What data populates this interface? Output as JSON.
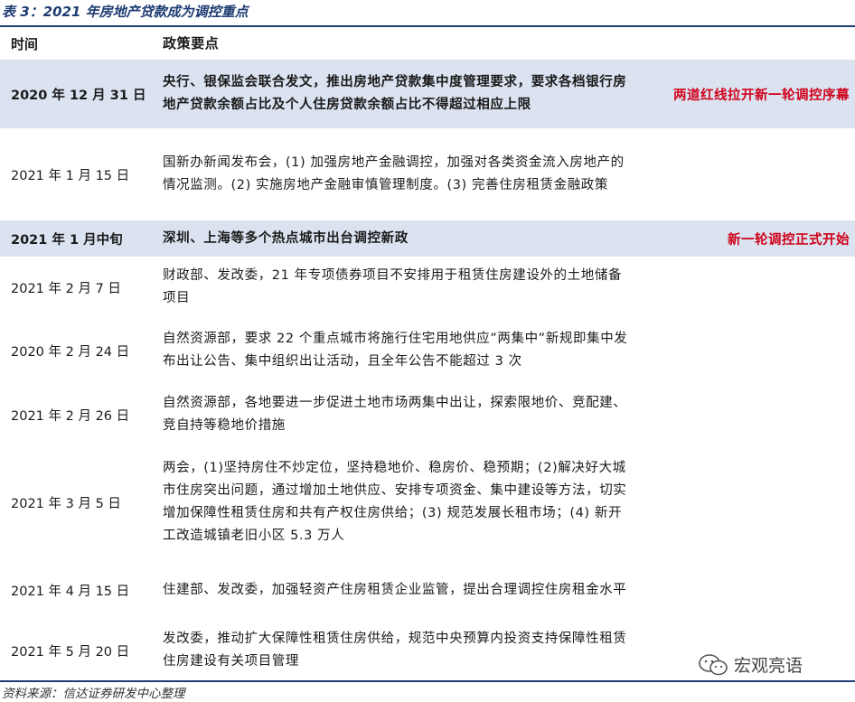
{
  "caption": "表 3：2021 年房地产贷款成为调控重点",
  "header": {
    "time": "时间",
    "points": "政策要点",
    "note": ""
  },
  "rows": [
    {
      "time": "2020 年 12 月 31 日",
      "points": "央行、银保监会联合发文，推出房地产贷款集中度管理要求，要求各档银行房地产贷款余额占比及个人住房贷款余额占比不得超过相应上限",
      "note": "两道红线拉开新一轮调控序幕",
      "highlight": true
    },
    {
      "time": "2021 年 1 月 15 日",
      "points": "国新办新闻发布会，(1) 加强房地产金融调控，加强对各类资金流入房地产的情况监测。(2) 实施房地产金融审慎管理制度。(3) 完善住房租赁金融政策",
      "note": "",
      "highlight": false
    },
    {
      "time": "2021 年 1 月中旬",
      "points": "深圳、上海等多个热点城市出台调控新政",
      "note": "新一轮调控正式开始",
      "highlight": true
    },
    {
      "time": "2021 年 2 月 7 日",
      "points": "财政部、发改委，21 年专项债券项目不安排用于租赁住房建设外的土地储备项目",
      "note": "",
      "highlight": false
    },
    {
      "time": "2020 年 2 月 24 日",
      "points": "自然资源部，要求 22 个重点城市将施行住宅用地供应”两集中”新规即集中发布出让公告、集中组织出让活动，且全年公告不能超过 3 次",
      "note": "",
      "highlight": false
    },
    {
      "time": "2021 年 2 月 26 日",
      "points": "自然资源部，各地要进一步促进土地市场两集中出让，探索限地价、竞配建、竞自持等稳地价措施",
      "note": "",
      "highlight": false
    },
    {
      "time": "2021 年 3 月 5 日",
      "points": "两会，(1)坚持房住不炒定位，坚持稳地价、稳房价、稳预期；(2)解决好大城市住房突出问题，通过增加土地供应、安排专项资金、集中建设等方法，切实增加保障性租赁住房和共有产权住房供给；(3) 规范发展长租市场；(4) 新开工改造城镇老旧小区 5.3 万人",
      "note": "",
      "highlight": false
    },
    {
      "time": "2021 年 4 月 15 日",
      "points": "住建部、发改委，加强轻资产住房租赁企业监管，提出合理调控住房租金水平",
      "note": "",
      "highlight": false
    },
    {
      "time": "2021 年 5 月 20 日",
      "points": "发改委，推动扩大保障性租赁住房供给，规范中央预算内投资支持保障性租赁住房建设有关项目管理",
      "note": "",
      "highlight": false
    }
  ],
  "source": "资料来源：信达证券研发中心整理",
  "watermark": {
    "icon": "wechat-icon",
    "text": "宏观亮语"
  },
  "colors": {
    "accent": "#1f3d73",
    "highlight_bg": "#dbe3f1",
    "note_red": "#d0021b"
  }
}
